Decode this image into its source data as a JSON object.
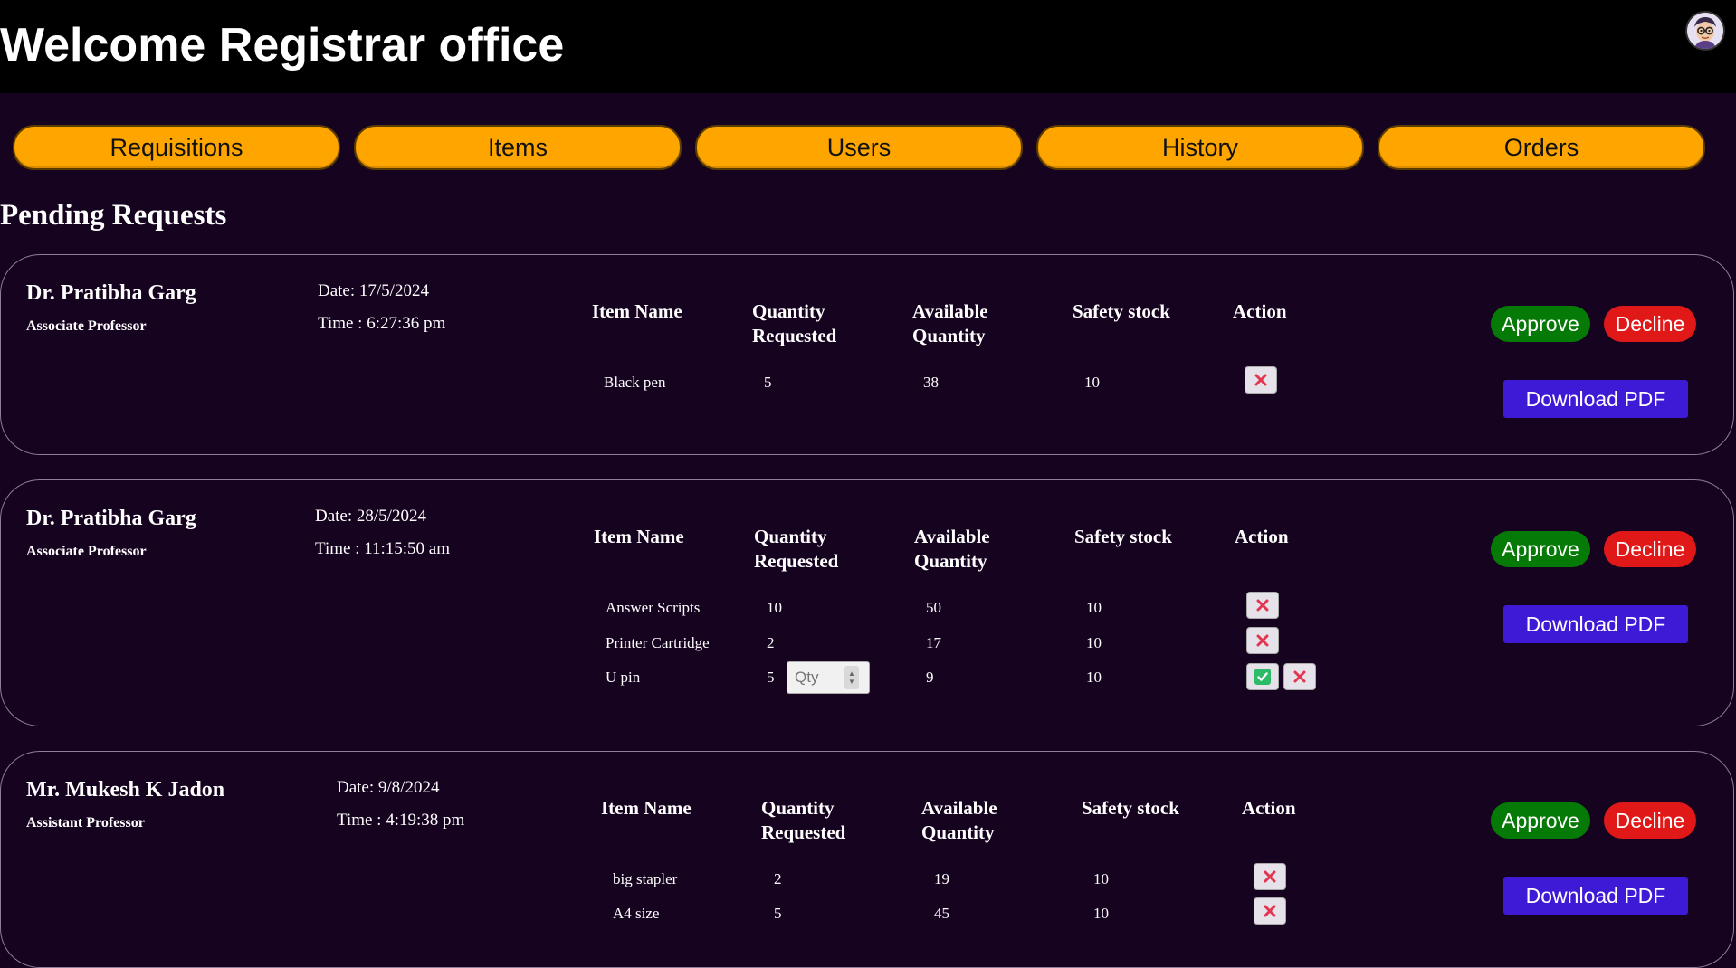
{
  "header": {
    "title": "Welcome Registrar office"
  },
  "nav": [
    "Requisitions",
    "Items",
    "Users",
    "History",
    "Orders"
  ],
  "section_title": "Pending Requests",
  "columns": {
    "item_name": "Item Name",
    "qty_requested": [
      "Quantity",
      "Requested"
    ],
    "available": [
      "Available",
      "Quantity"
    ],
    "safety": "Safety stock",
    "action": "Action"
  },
  "buttons": {
    "approve": "Approve",
    "decline": "Decline",
    "pdf": "Download PDF"
  },
  "qty_placeholder": "Qty",
  "requests": [
    {
      "name": "Dr. Pratibha Garg",
      "designation": "Associate Professor",
      "date": "Date: 17/5/2024",
      "time": "Time : 6:27:36 pm",
      "items": [
        {
          "name": "Black pen",
          "requested": "5",
          "available": "38",
          "safety": "10"
        }
      ]
    },
    {
      "name": "Dr. Pratibha Garg",
      "designation": "Associate Professor",
      "date": "Date: 28/5/2024",
      "time": "Time : 11:15:50 am",
      "items": [
        {
          "name": "Answer Scripts",
          "requested": "10",
          "available": "50",
          "safety": "10"
        },
        {
          "name": "Printer Cartridge",
          "requested": "2",
          "available": "17",
          "safety": "10"
        },
        {
          "name": "U pin",
          "requested": "5",
          "available": "9",
          "safety": "10"
        }
      ]
    },
    {
      "name": "Mr. Mukesh K Jadon",
      "designation": "Assistant Professor",
      "date": "Date: 9/8/2024",
      "time": "Time : 4:19:38 pm",
      "items": [
        {
          "name": "big stapler",
          "requested": "2",
          "available": "19",
          "safety": "10"
        },
        {
          "name": "A4 size",
          "requested": "5",
          "available": "45",
          "safety": "10"
        }
      ]
    }
  ]
}
